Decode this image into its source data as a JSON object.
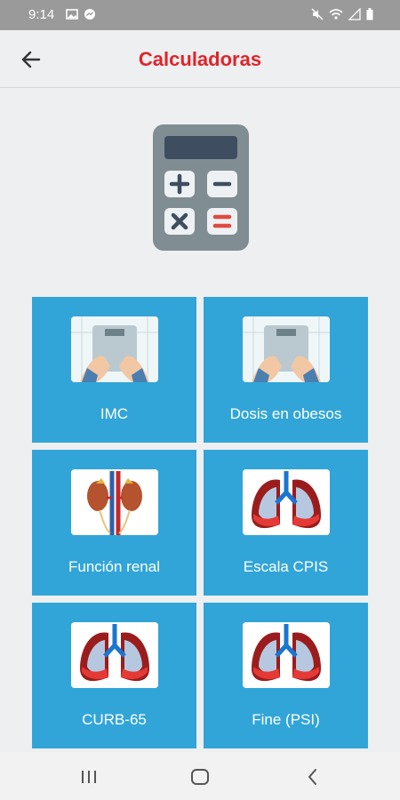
{
  "status_bar": {
    "time": "9:14",
    "left_icons": [
      "image-icon",
      "messenger-icon"
    ],
    "right_icons": [
      "mute-icon",
      "wifi-icon",
      "signal-icon",
      "battery-icon"
    ]
  },
  "header": {
    "title": "Calculadoras",
    "back_icon": "arrow-left-icon",
    "title_color": "#e0242b"
  },
  "hero_icon": "calculator-icon",
  "tiles": [
    {
      "label": "IMC",
      "image": "scale-image"
    },
    {
      "label": "Dosis en obesos",
      "image": "scale-image"
    },
    {
      "label": "Función renal",
      "image": "kidneys-image"
    },
    {
      "label": "Escala CPIS",
      "image": "lungs-image"
    },
    {
      "label": "CURB-65",
      "image": "lungs-image"
    },
    {
      "label": "Fine (PSI)",
      "image": "lungs-image"
    }
  ],
  "colors": {
    "tile_bg": "#31a5d8",
    "page_bg": "#eeeff1"
  },
  "nav_bar": [
    "recents-icon",
    "home-icon",
    "back-icon"
  ]
}
